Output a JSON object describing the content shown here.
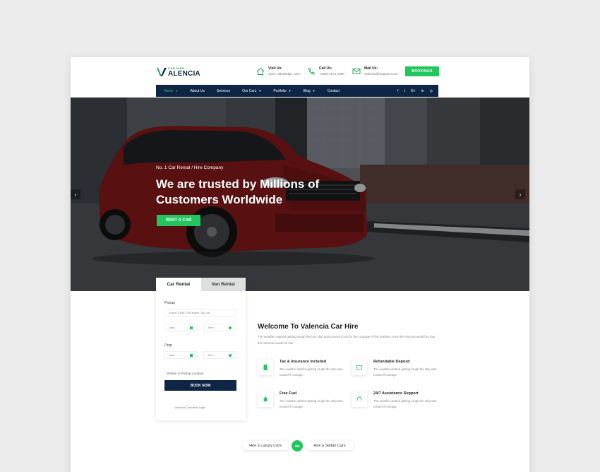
{
  "brand": {
    "small": "CAR HIRE",
    "name": "ALENCIA",
    "mark": "V"
  },
  "contacts": [
    {
      "label": "Visit Us:",
      "value": "1234, Nantwidge, USA",
      "icon": "home-icon"
    },
    {
      "label": "Call Us:",
      "value": "+1800-1574-1990",
      "icon": "phone-icon"
    },
    {
      "label": "Mail Us:",
      "value": "valencia@Support.Com",
      "icon": "mail-icon"
    }
  ],
  "booking_label": "BOOKINGS",
  "nav": {
    "items": [
      {
        "label": "Home",
        "dropdown": true,
        "active": true
      },
      {
        "label": "About Us",
        "dropdown": false,
        "active": false
      },
      {
        "label": "Services",
        "dropdown": false,
        "active": false
      },
      {
        "label": "Our Cars",
        "dropdown": true,
        "active": false
      },
      {
        "label": "Portfolio",
        "dropdown": true,
        "active": false
      },
      {
        "label": "Blog",
        "dropdown": true,
        "active": false
      },
      {
        "label": "Contact",
        "dropdown": false,
        "active": false
      }
    ],
    "social": [
      "f",
      "t",
      "G+",
      "in",
      "◎"
    ]
  },
  "hero": {
    "subtitle": "No. 1 Car Rental / Hire Company",
    "title": "We are trusted by Millions of Customers Worldwide",
    "button": "RENT A CAR"
  },
  "form": {
    "tabs": [
      "Car Rental",
      "Van Rental"
    ],
    "pickup_label": "Pickup",
    "pickup_placeholder": "Airport Code, City Name, Zip, etc",
    "date_placeholder": "Date",
    "time_placeholder": "Time",
    "drop_label": "Drop",
    "return_label": "Return to Pickup Location",
    "book_now": "BOOK NOW",
    "login_text": "Valencia Customer Login"
  },
  "welcome": {
    "title": "Welcome To Valencia Car Hire",
    "text": "The weather started getting rough the tiny ship was tossed if not for the courage of the fearless crew the minnow would be lost the minnow would be lost."
  },
  "features": [
    {
      "title": "Tax & Insurance Included",
      "text": "The weather started getting rough the ship was tossed if courage.",
      "icon": "document-icon"
    },
    {
      "title": "Refundable Deposit",
      "text": "The weather started getting rough the ship was tossed if courage.",
      "icon": "wallet-icon"
    },
    {
      "title": "Free Fuel",
      "text": "The weather started getting rough the ship was tossed if courage.",
      "icon": "fuel-drop-icon"
    },
    {
      "title": "24/7 Assistance Support",
      "text": "The weather started getting rough the ship was tossed if courage.",
      "icon": "support-icon"
    }
  ],
  "bottom": {
    "left": "Hire a Luxury Cars",
    "or": "OR",
    "right": "Hire a Sedan Cars"
  },
  "colors": {
    "accent": "#22c55e",
    "navy": "#0f2546",
    "car": "#8b1c1c"
  }
}
